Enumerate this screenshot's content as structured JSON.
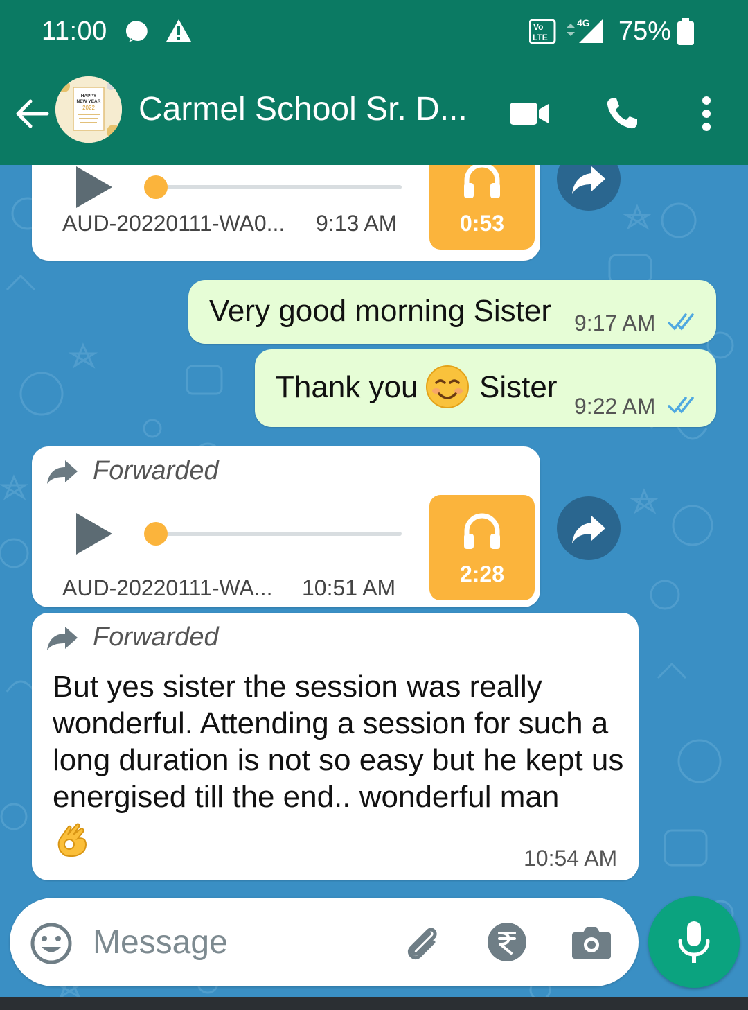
{
  "status_bar": {
    "time": "11:00",
    "network": "4G",
    "volte": "Vo LTE",
    "battery": "75%"
  },
  "header": {
    "title": "Carmel School Sr. D...",
    "avatar_text": "HAPPY NEW YEAR 2022",
    "colors": {
      "bar": "#0b7a63"
    }
  },
  "messages": [
    {
      "type": "audio",
      "direction": "incoming",
      "file": "AUD-20220111-WA0...",
      "time": "9:13 AM",
      "duration": "0:53",
      "progress": 0
    },
    {
      "type": "text",
      "direction": "outgoing",
      "text": "Very good morning Sister",
      "time": "9:17 AM",
      "status": "read"
    },
    {
      "type": "text",
      "direction": "outgoing",
      "text_before": "Thank you",
      "emoji": "smiling-face-icon",
      "text_after": "Sister",
      "time": "9:22 AM",
      "status": "read"
    },
    {
      "type": "audio",
      "direction": "incoming",
      "forwarded_label": "Forwarded",
      "file": "AUD-20220111-WA...",
      "time": "10:51 AM",
      "duration": "2:28",
      "progress": 0
    },
    {
      "type": "text",
      "direction": "incoming",
      "forwarded_label": "Forwarded",
      "text": "But yes sister the session was really wonderful. Attending a session for such a long duration is not so easy but he kept us energised till the end.. wonderful man",
      "emoji": "ok-hand-icon",
      "time": "10:54 AM"
    }
  ],
  "input": {
    "placeholder": "Message"
  },
  "colors": {
    "accent": "#0ba37f",
    "outgoing_bubble": "#e6fdd6",
    "audio_thumb": "#fbb43c",
    "tick_read": "#4fa8e0",
    "chat_background": "#3a8fc4"
  }
}
